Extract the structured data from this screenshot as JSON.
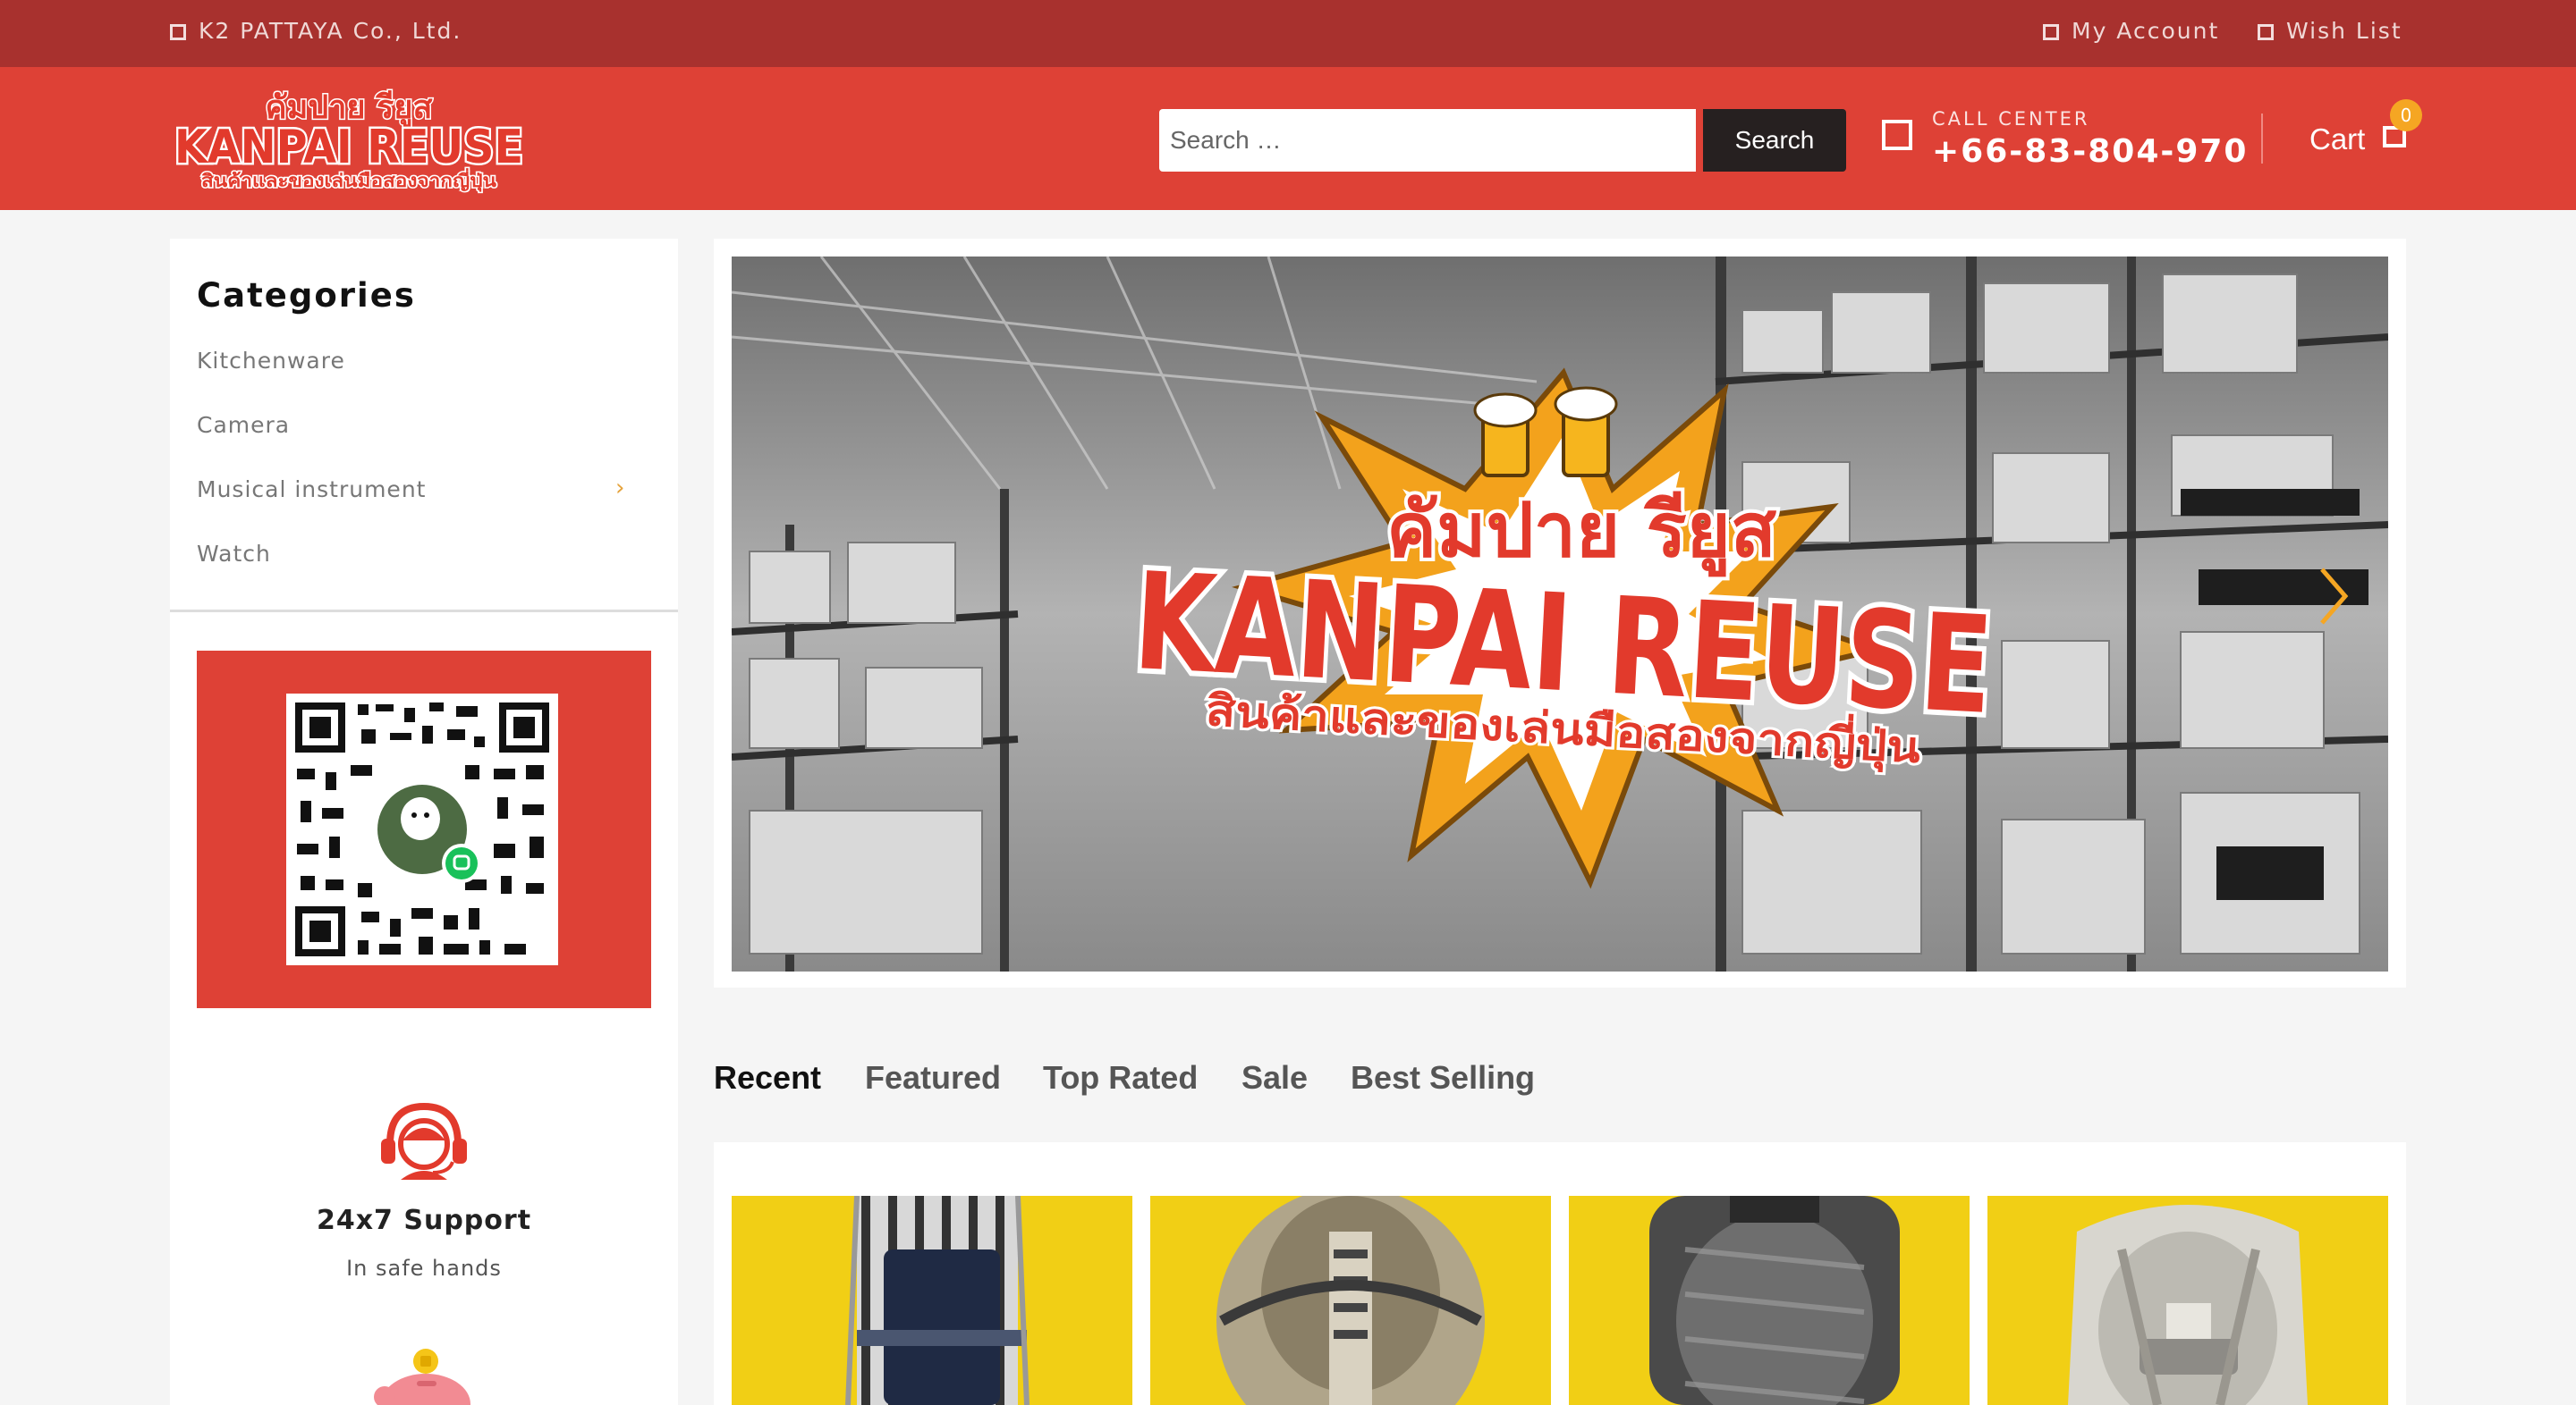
{
  "topbar": {
    "company": "K2 PATTAYA Co., Ltd.",
    "my_account": "My Account",
    "wish_list": "Wish List"
  },
  "header": {
    "logo_thai": "คัมปาย รียูส",
    "logo_text": "KANPAI REUSE",
    "logo_tagline": "สินค้าและของเล่นมือสองจากญี่ปุ่น",
    "search_placeholder": "Search …",
    "search_button": "Search",
    "call_label": "CALL CENTER",
    "call_number": "+66-83-804-970",
    "cart_label": "Cart",
    "cart_count": "0"
  },
  "sidebar": {
    "categories_title": "Categories",
    "categories": [
      {
        "label": "Kitchenware",
        "has_children": false
      },
      {
        "label": "Camera",
        "has_children": false
      },
      {
        "label": "Musical instrument",
        "has_children": true
      },
      {
        "label": "Watch",
        "has_children": false
      }
    ],
    "support_title": "24x7 Support",
    "support_subtitle": "In safe hands"
  },
  "hero": {
    "logo_thai": "คัมปาย รียูส",
    "logo_text": "KANPAI REUSE",
    "logo_tagline": "สินค้าและของเล่นมือสองจากญี่ปุ่น"
  },
  "tabs": [
    {
      "label": "Recent",
      "active": true
    },
    {
      "label": "Featured",
      "active": false
    },
    {
      "label": "Top Rated",
      "active": false
    },
    {
      "label": "Sale",
      "active": false
    },
    {
      "label": "Best Selling",
      "active": false
    }
  ],
  "colors": {
    "topbar": "#a8312e",
    "header": "#de4136",
    "accent": "#f5a623",
    "product_bg": "#f1cf15"
  },
  "icons": [
    "square-icon",
    "phone-icon",
    "cart-icon",
    "chevron-right-icon",
    "headset-icon",
    "piggy-bank-icon",
    "qr-code-icon"
  ]
}
